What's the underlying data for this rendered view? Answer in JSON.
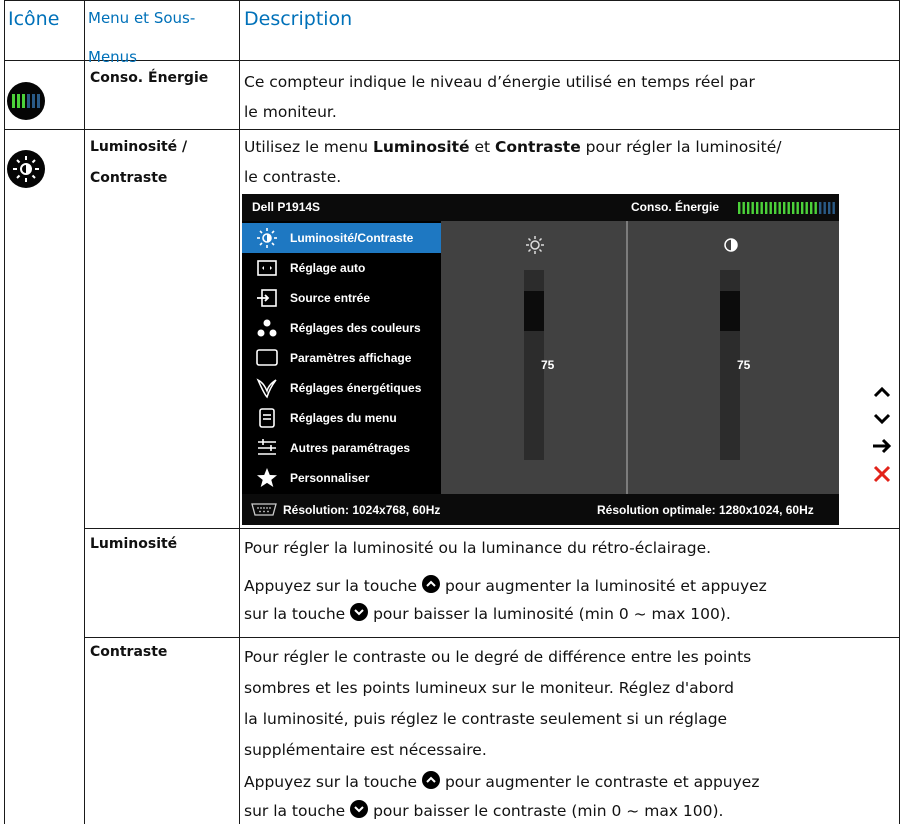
{
  "table": {
    "headers": {
      "icon": "Icône",
      "menu_line1": "Menu et Sous-",
      "menu_line2": "Menus",
      "description": "Description"
    },
    "row_energy": {
      "label": "Conso. Énergie",
      "desc_line1": "Ce compteur indique le niveau d’énergie utilisé en temps réel par",
      "desc_line2": "le moniteur."
    },
    "row_brightness_contrast": {
      "label_line1": "Luminosité /",
      "label_line2": "Contraste",
      "desc_pre": "Utilisez le menu ",
      "desc_bold1": "Luminosité",
      "desc_mid": " et ",
      "desc_bold2": "Contraste",
      "desc_post": " pour régler la luminosité/",
      "desc_line2": "le contraste."
    },
    "row_brightness": {
      "label": "Luminosité",
      "desc_line1": "Pour régler la luminosité ou la luminance du rétro-éclairage.",
      "desc_line2_pre": "Appuyez sur la touche",
      "desc_line2_post": "pour augmenter la luminosité et appuyez",
      "desc_line3_pre": "sur la touche",
      "desc_line3_post": "pour baisser la luminosité (min 0 ~ max 100)."
    },
    "row_contrast": {
      "label": "Contraste",
      "desc_line1": "Pour régler le contraste ou le degré de différence entre les points",
      "desc_line2": "sombres et les points lumineux sur le moniteur.  Réglez d'abord",
      "desc_line3": "la luminosité, puis réglez le contraste seulement si un réglage",
      "desc_line4": "supplémentaire est nécessaire.",
      "desc_line5_pre": "Appuyez sur la touche",
      "desc_line5_post": "pour augmenter le contraste et appuyez",
      "desc_line6_pre": "sur la touche",
      "desc_line6_post": "pour baisser le contraste (min 0 ~ max 100)."
    }
  },
  "osd": {
    "model": "Dell P1914S",
    "energy_label": "Conso. Énergie",
    "menu_items": [
      {
        "label": "Luminosité/Contraste",
        "icon": "brightness-icon"
      },
      {
        "label": "Réglage auto",
        "icon": "auto-adjust-icon"
      },
      {
        "label": "Source entrée",
        "icon": "input-source-icon"
      },
      {
        "label": "Réglages des couleurs",
        "icon": "color-settings-icon"
      },
      {
        "label": "Paramètres affichage",
        "icon": "display-settings-icon"
      },
      {
        "label": "Réglages énergétiques",
        "icon": "energy-settings-icon"
      },
      {
        "label": "Réglages du menu",
        "icon": "menu-settings-icon"
      },
      {
        "label": "Autres paramétrages",
        "icon": "other-settings-icon"
      },
      {
        "label": "Personnaliser",
        "icon": "star-icon"
      }
    ],
    "brightness_value": "75",
    "contrast_value": "75",
    "brightness_level": 0.75,
    "contrast_level": 0.75,
    "resolution": "Résolution: 1024x768,  60Hz",
    "optimal_resolution": "Résolution optimale: 1280x1024,  60Hz",
    "accent_color": "#1e78c2"
  },
  "colors": {
    "header_blue": "#0071b9",
    "energy_green": "#4cd23a",
    "close_red": "#e2231a"
  }
}
